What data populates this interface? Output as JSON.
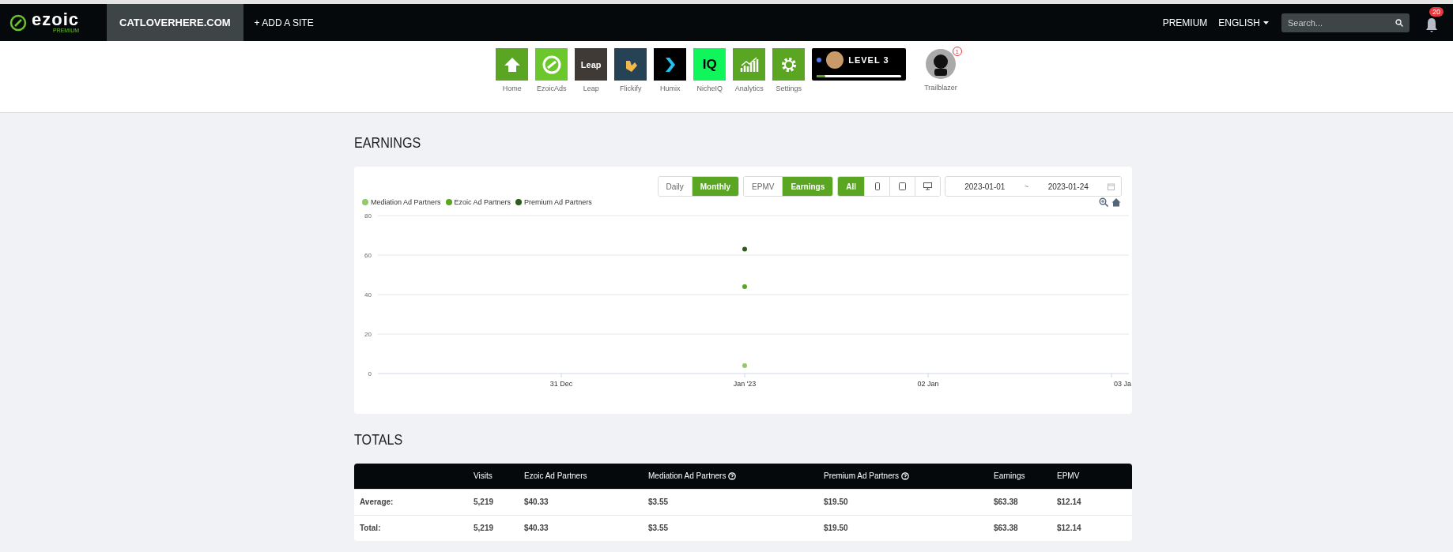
{
  "nav": {
    "brand": "ezoic",
    "brand_tier": "PREMIUM",
    "site_tab": {
      "label": "CATLOVERHERE.COM",
      "selected": true
    },
    "add_site": "+ ADD A SITE",
    "premium_link": "PREMIUM",
    "language": "ENGLISH",
    "search": {
      "placeholder": "Search..."
    },
    "notifications": "20"
  },
  "apps": [
    {
      "label": "Home",
      "kind": "home"
    },
    {
      "label": "EzoicAds",
      "kind": "ezoicads"
    },
    {
      "label": "Leap",
      "kind": "leap",
      "tile_text": "Leap"
    },
    {
      "label": "Flickify",
      "kind": "flickify"
    },
    {
      "label": "Humix",
      "kind": "humix"
    },
    {
      "label": "NicheIQ",
      "kind": "nicheiq",
      "tile_text": "IQ"
    },
    {
      "label": "Analytics",
      "kind": "analytics"
    },
    {
      "label": "Settings",
      "kind": "settings"
    }
  ],
  "level_card": {
    "label": "LEVEL 3",
    "level": 0.1
  },
  "trailblazer": {
    "label": "Trailblazer",
    "badge": "1"
  },
  "earnings": {
    "title": "EARNINGS",
    "period": [
      {
        "label": "Daily",
        "selected": false
      },
      {
        "label": "Monthly",
        "selected": true
      }
    ],
    "metric": [
      {
        "label": "EPMV",
        "selected": false
      },
      {
        "label": "Earnings",
        "selected": true
      }
    ],
    "device": [
      {
        "kind": "all",
        "label": "All",
        "selected": true
      },
      {
        "kind": "phone",
        "selected": false
      },
      {
        "kind": "tablet",
        "selected": false
      },
      {
        "kind": "desktop",
        "selected": false
      }
    ],
    "date_from": "2023-01-01",
    "date_separator": "~",
    "date_to": "2023-01-24",
    "chart_data": {
      "type": "scatter",
      "grid": true,
      "categories": [
        "31 Dec",
        "Jan '23",
        "02 Jan",
        "03 Ja"
      ],
      "yticks": [
        0,
        20,
        40,
        60,
        80
      ],
      "ylim": [
        0,
        80
      ],
      "series": [
        {
          "name": "Mediation Ad Partners",
          "color": "#93c96b",
          "values": [
            null,
            4,
            null,
            null
          ]
        },
        {
          "name": "Ezoic Ad Partners",
          "color": "#5aa623",
          "values": [
            null,
            44,
            null,
            null
          ]
        },
        {
          "name": "Premium Ad Partners",
          "color": "#2d5e17",
          "values": [
            null,
            63,
            null,
            null
          ]
        }
      ]
    }
  },
  "totals": {
    "title": "TOTALS",
    "columns": [
      {
        "label": "Visits",
        "help": false
      },
      {
        "label": "Ezoic Ad Partners",
        "help": false
      },
      {
        "label": "Mediation Ad Partners",
        "help": true
      },
      {
        "label": "Premium Ad Partners",
        "help": true
      },
      {
        "label": "Earnings",
        "help": false
      },
      {
        "label": "EPMV",
        "help": false
      }
    ],
    "rows": [
      {
        "label": "Average:",
        "cells": [
          "5,219",
          "$40.33",
          "$3.55",
          "$19.50",
          "$63.38",
          "$12.14"
        ]
      },
      {
        "label": "Total:",
        "cells": [
          "5,219",
          "$40.33",
          "$3.55",
          "$19.50",
          "$63.38",
          "$12.14"
        ]
      }
    ]
  }
}
